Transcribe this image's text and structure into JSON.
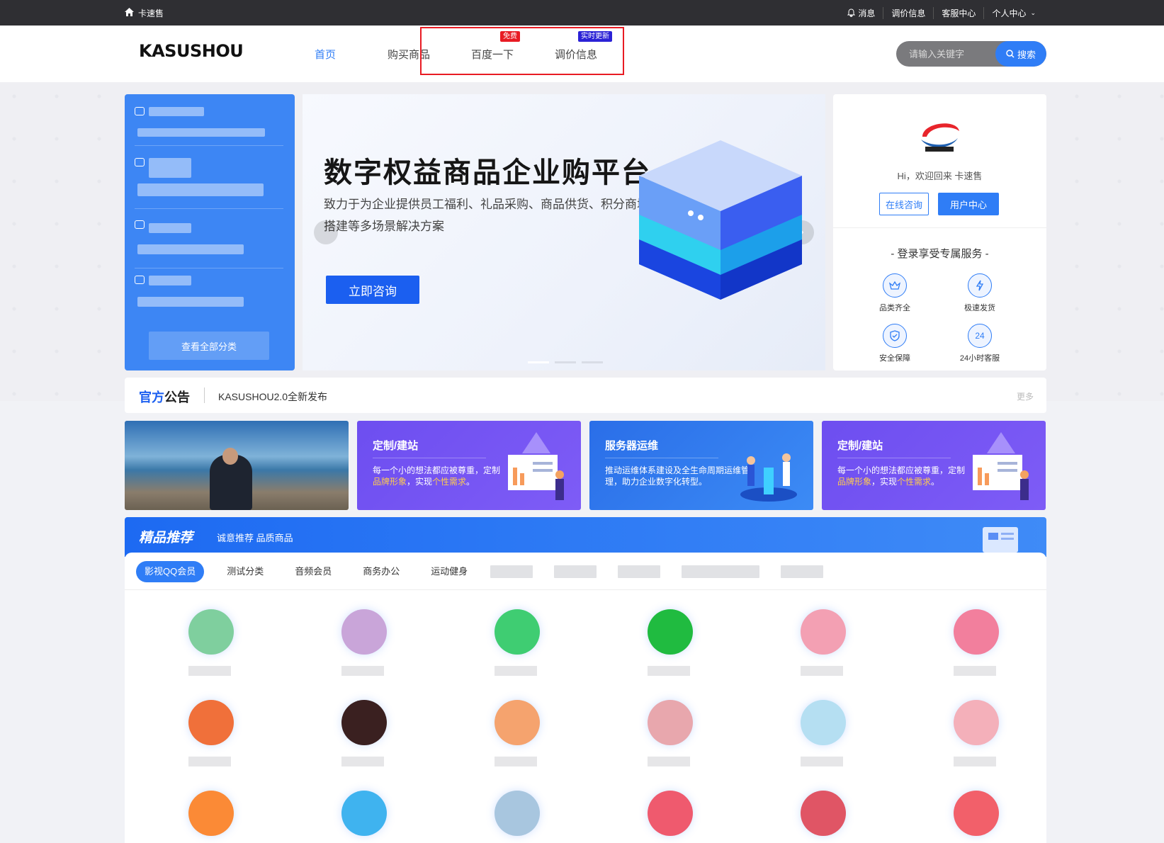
{
  "topbar": {
    "home_label": "卡速售",
    "links": [
      "消息",
      "调价信息",
      "客服中心",
      "个人中心"
    ]
  },
  "header": {
    "logo": "KASUSHOU",
    "nav": [
      {
        "label": "首页",
        "active": true
      },
      {
        "label": "购买商品"
      },
      {
        "label": "百度一下",
        "badge": "免费"
      },
      {
        "label": "调价信息",
        "badge": "实时更新"
      }
    ],
    "search": {
      "placeholder": "请输入关键字",
      "button": "搜索"
    }
  },
  "categories": {
    "view_all": "查看全部分类"
  },
  "banner": {
    "title": "数字权益商品企业购平台",
    "subtitle": "致力于为企业提供员工福利、礼品采购、商品供货、积分商城搭建等多场景解决方案",
    "cta": "立即咨询"
  },
  "user": {
    "greeting": "Hi，欢迎回来 卡速售",
    "consult_button": "在线咨询",
    "center_button": "用户中心",
    "services_title": "- 登录享受专属服务 -",
    "services": [
      {
        "label": "品类齐全",
        "icon": "crown-icon"
      },
      {
        "label": "极速发货",
        "icon": "lightning-icon"
      },
      {
        "label": "安全保障",
        "icon": "shield-icon"
      },
      {
        "label": "24小时客服",
        "icon": "clock-24-icon",
        "glyph": "24"
      }
    ]
  },
  "notice": {
    "title_a": "官方",
    "title_b": "公告",
    "message": "KASUSHOU2.0全新发布",
    "more": "更多"
  },
  "promos": [
    {
      "title": "定制/建站",
      "desc_a": "每一个小的想法都应被尊重，定制",
      "hl1": "品牌形象",
      "desc_b": "，实现",
      "hl2": "个性需求",
      "desc_c": "。"
    },
    {
      "title": "服务器运维",
      "desc_a": "推动运维体系建设及全生命周期运维管理，助力企业数字化转型。"
    },
    {
      "title": "定制/建站",
      "desc_a": "每一个小的想法都应被尊重，定制",
      "hl1": "品牌形象",
      "desc_b": "，实现",
      "hl2": "个性需求",
      "desc_c": "。"
    }
  ],
  "recommend": {
    "title": "精品推荐",
    "subtitle": "诚意推荐 品质商品",
    "tabs": [
      "影视QQ会员",
      "测试分类",
      "音频会员",
      "商务办公",
      "运动健身"
    ]
  },
  "colors": {
    "accent": "#2f7df6",
    "topbar": "#2f2f33",
    "highlight_border": "#e81b23"
  },
  "products": [
    {
      "color": "#7fcf9e"
    },
    {
      "color": "#c9a5d9"
    },
    {
      "color": "#3fcd72"
    },
    {
      "color": "#20bb40"
    },
    {
      "color": "#f3a0b3"
    },
    {
      "color": "#f27f9d"
    },
    {
      "color": "#f0703a"
    },
    {
      "color": "#3a2020"
    },
    {
      "color": "#f5a36e"
    },
    {
      "color": "#e8a7ad"
    },
    {
      "color": "#b5dff2"
    },
    {
      "color": "#f4b0ba"
    },
    {
      "color": "#fb8a36"
    },
    {
      "color": "#3fb3ef"
    },
    {
      "color": "#a8c6df"
    },
    {
      "color": "#ef5a6e"
    },
    {
      "color": "#e05565"
    },
    {
      "color": "#f2606a"
    }
  ]
}
